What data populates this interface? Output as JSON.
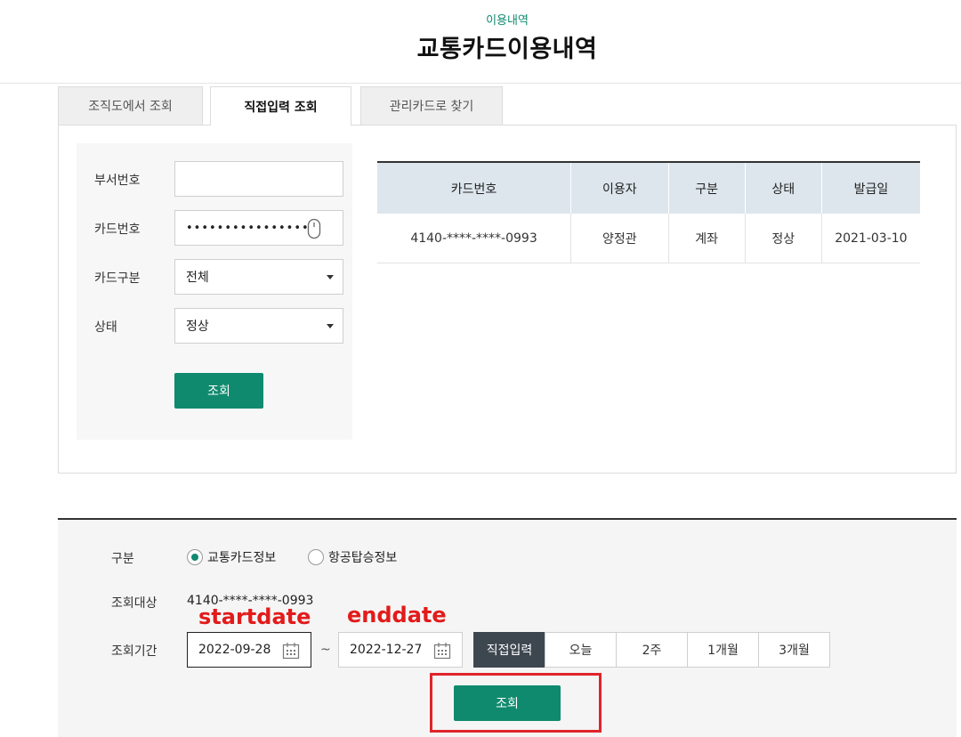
{
  "header": {
    "breadcrumb": "이용내역",
    "title": "교통카드이용내역"
  },
  "tabs": [
    {
      "label": "조직도에서 조회"
    },
    {
      "label": "직접입력 조회"
    },
    {
      "label": "관리카드로 찾기"
    }
  ],
  "form": {
    "dept_label": "부서번호",
    "dept_value": "",
    "card_label": "카드번호",
    "card_value": "••••••••••••••••",
    "card_type_label": "카드구분",
    "card_type_value": "전체",
    "status_label": "상태",
    "status_value": "정상",
    "search_button": "조회"
  },
  "result": {
    "columns": [
      "카드번호",
      "이용자",
      "구분",
      "상태",
      "발급일"
    ],
    "rows": [
      [
        "4140-****-****-0993",
        "양정관",
        "계좌",
        "정상",
        "2021-03-10"
      ]
    ]
  },
  "bottom": {
    "type_label": "구분",
    "radio_transit": "교통카드정보",
    "radio_flight": "항공탑승정보",
    "target_label": "조회대상",
    "target_value": "4140-****-****-0993",
    "period_label": "조회기간",
    "start_date": "2022-09-28",
    "end_date": "2022-12-27",
    "tilde": "~",
    "periods": [
      "직접입력",
      "오늘",
      "2주",
      "1개월",
      "3개월"
    ],
    "search_button": "조회"
  },
  "annotations": {
    "start": "startdate",
    "end": "enddate"
  },
  "colors": {
    "accent": "#108a6e",
    "annotation": "#e21b1b",
    "selected_period": "#3d4750"
  }
}
